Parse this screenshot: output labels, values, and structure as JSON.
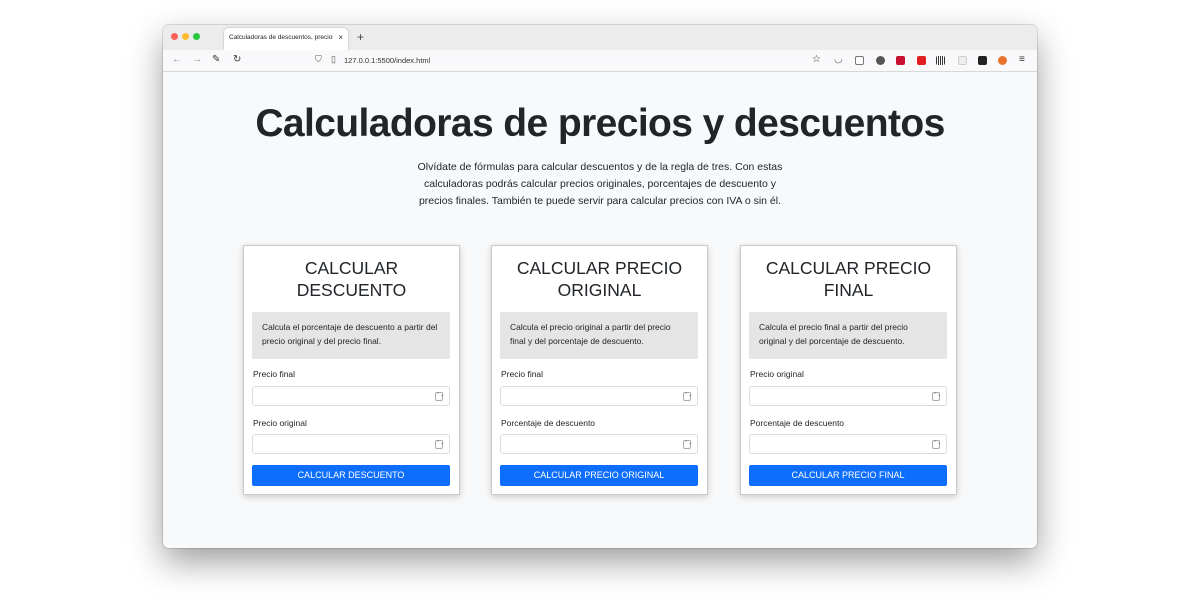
{
  "browser": {
    "tab_title": "Calculadoras de descuentos, precios y porcentajes",
    "tab_close": "×",
    "new_tab": "+",
    "url": "127.0.0.1:5500/index.html"
  },
  "page": {
    "title": "Calculadoras de precios y descuentos",
    "intro": "Olvídate de fórmulas para calcular descuentos y de la regla de tres. Con estas calculadoras podrás calcular precios originales, porcentajes de descuento y precios finales. También te puede servir para calcular precios con IVA o sin él."
  },
  "cards": [
    {
      "title_line1": "CALCULAR",
      "title_line2": "DESCUENTO",
      "description": "Calcula el porcentaje de descuento a partir del precio original y del precio final.",
      "field1_label": "Precio final",
      "field2_label": "Precio original",
      "button": "CALCULAR DESCUENTO"
    },
    {
      "title_line1": "CALCULAR PRECIO",
      "title_line2": "ORIGINAL",
      "description": "Calcula el precio original a partir del precio final y del porcentaje de descuento.",
      "field1_label": "Precio final",
      "field2_label": "Porcentaje de descuento",
      "button": "CALCULAR PRECIO ORIGINAL"
    },
    {
      "title_line1": "CALCULAR PRECIO",
      "title_line2": "FINAL",
      "description": "Calcula el precio final a partir del precio original y del porcentaje de descuento.",
      "field1_label": "Precio original",
      "field2_label": "Porcentaje de descuento",
      "button": "CALCULAR PRECIO FINAL"
    }
  ],
  "colors": {
    "primary_button": "#0d6efd",
    "page_background": "#f8f9fa",
    "description_background": "#e5e5e5"
  },
  "icons": [
    "back-arrow-icon",
    "forward-arrow-icon",
    "tools-icon",
    "reload-icon",
    "shield-icon",
    "page-icon",
    "bookmark-star-icon",
    "pocket-icon",
    "reader-icon",
    "menu-icon"
  ]
}
